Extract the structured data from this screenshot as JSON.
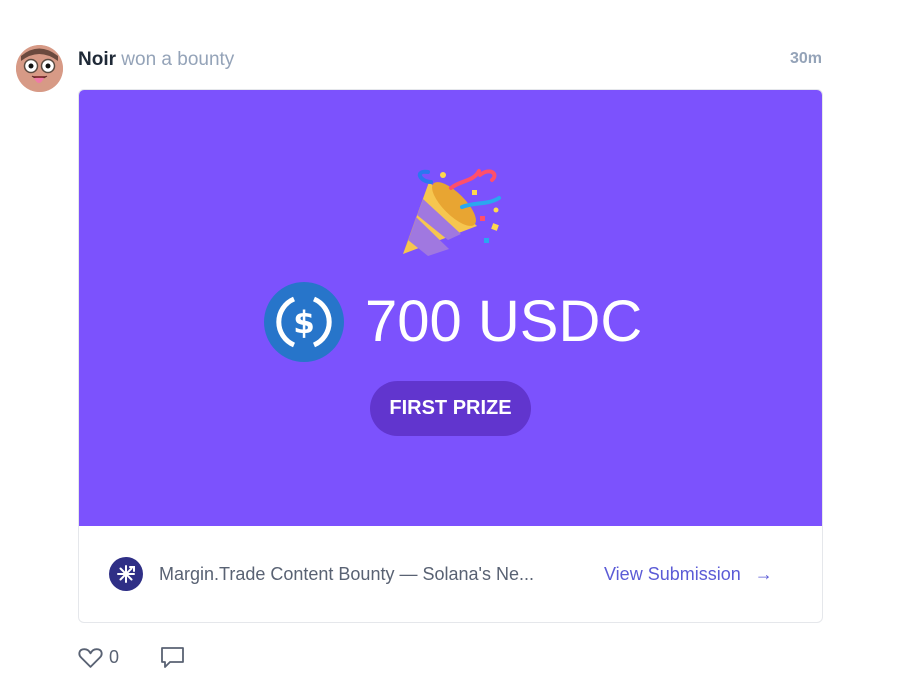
{
  "post": {
    "user": "Noir",
    "action": "won a bounty",
    "time": "30m"
  },
  "prize": {
    "amount": "700 USDC",
    "label": "FIRST PRIZE",
    "token_icon": "usdc-icon",
    "celebration_icon": "party-popper-icon",
    "banner_color": "#7c52fd",
    "badge_color": "#6135ce"
  },
  "bounty": {
    "title": "Margin.Trade Content Bounty — Solana's Ne...",
    "view_label": "View Submission",
    "arrow_icon": "arrow-right-icon",
    "link_color": "#5b5bd6"
  },
  "reactions": {
    "likes": "0",
    "like_icon": "heart-icon",
    "comment_icon": "comment-icon"
  }
}
